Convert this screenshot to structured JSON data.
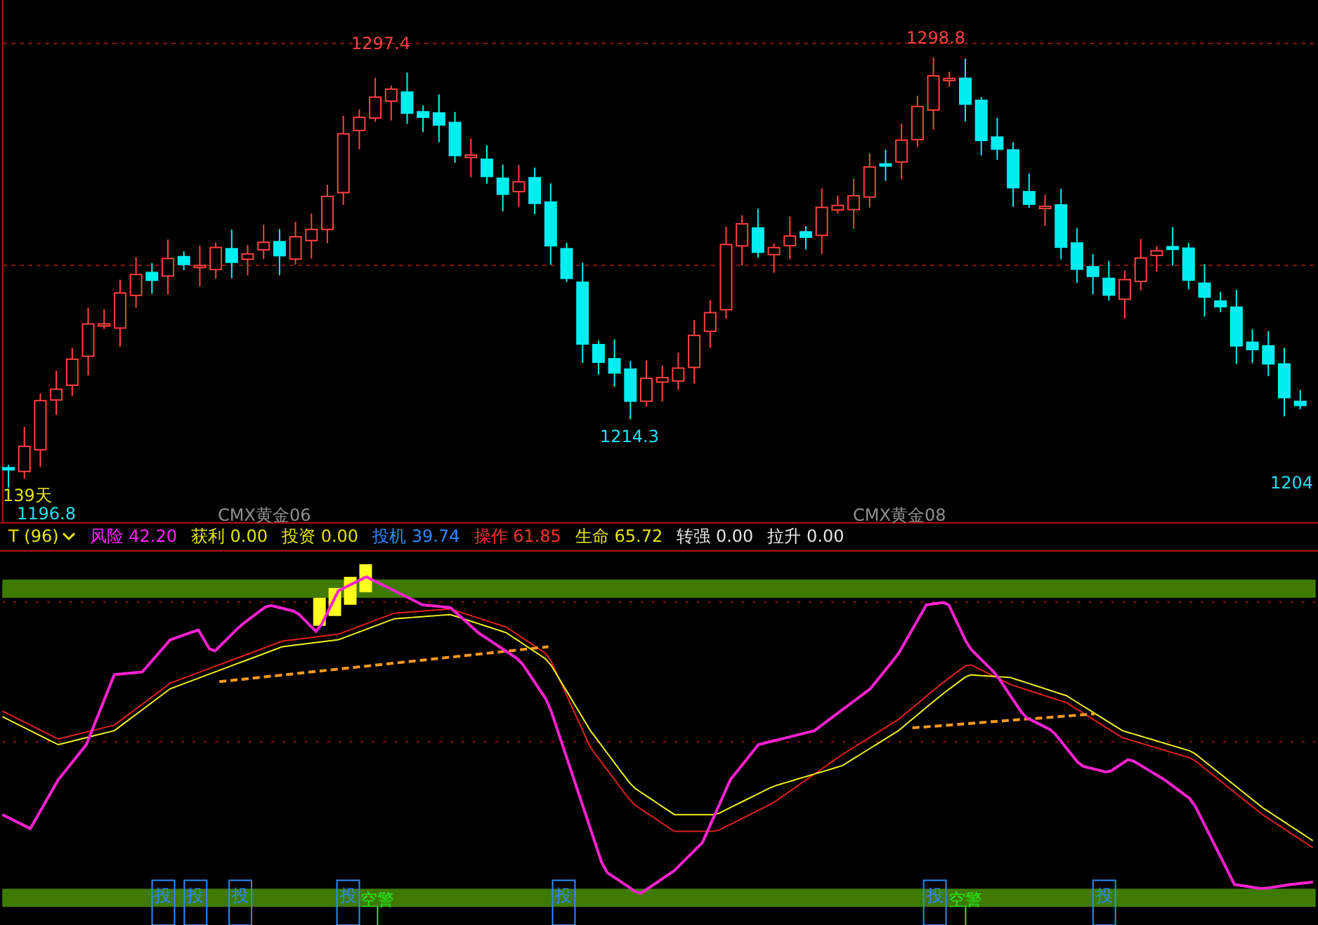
{
  "price_chart": {
    "labels": [
      {
        "text": "1297.4",
        "kind": "high"
      },
      {
        "text": "1298.8",
        "kind": "high"
      },
      {
        "text": "1214.3",
        "kind": "low"
      },
      {
        "text": "1204",
        "kind": "low"
      },
      {
        "text": "1196.8",
        "kind": "low"
      },
      {
        "text": "139天",
        "kind": "days"
      }
    ],
    "contracts": [
      "CMX黄金06",
      "CMX黄金08"
    ]
  },
  "indicator": {
    "name": "T (96)",
    "values": [
      {
        "label": "风险",
        "value": "42.20",
        "color": "#ff22ff"
      },
      {
        "label": "获利",
        "value": "0.00",
        "color": "#e6e600"
      },
      {
        "label": "投资",
        "value": "0.00",
        "color": "#e6e600"
      },
      {
        "label": "投机",
        "value": "39.74",
        "color": "#2a8cff"
      },
      {
        "label": "操作",
        "value": "61.85",
        "color": "#ff3030"
      },
      {
        "label": "生命",
        "value": "65.72",
        "color": "#e6e600"
      },
      {
        "label": "转强",
        "value": "0.00",
        "color": "#e8e8e8"
      },
      {
        "label": "拉升",
        "value": "0.00",
        "color": "#e8e8e8"
      }
    ]
  },
  "signals": [
    {
      "text": "投",
      "kind": "buy"
    },
    {
      "text": "投",
      "kind": "buy"
    },
    {
      "text": "投",
      "kind": "buy"
    },
    {
      "text": "投",
      "kind": "buy"
    },
    {
      "text": "空警",
      "kind": "warn"
    },
    {
      "text": "投",
      "kind": "buy"
    },
    {
      "text": "投",
      "kind": "buy"
    },
    {
      "text": "空警",
      "kind": "warn"
    },
    {
      "text": "投",
      "kind": "buy"
    }
  ]
}
